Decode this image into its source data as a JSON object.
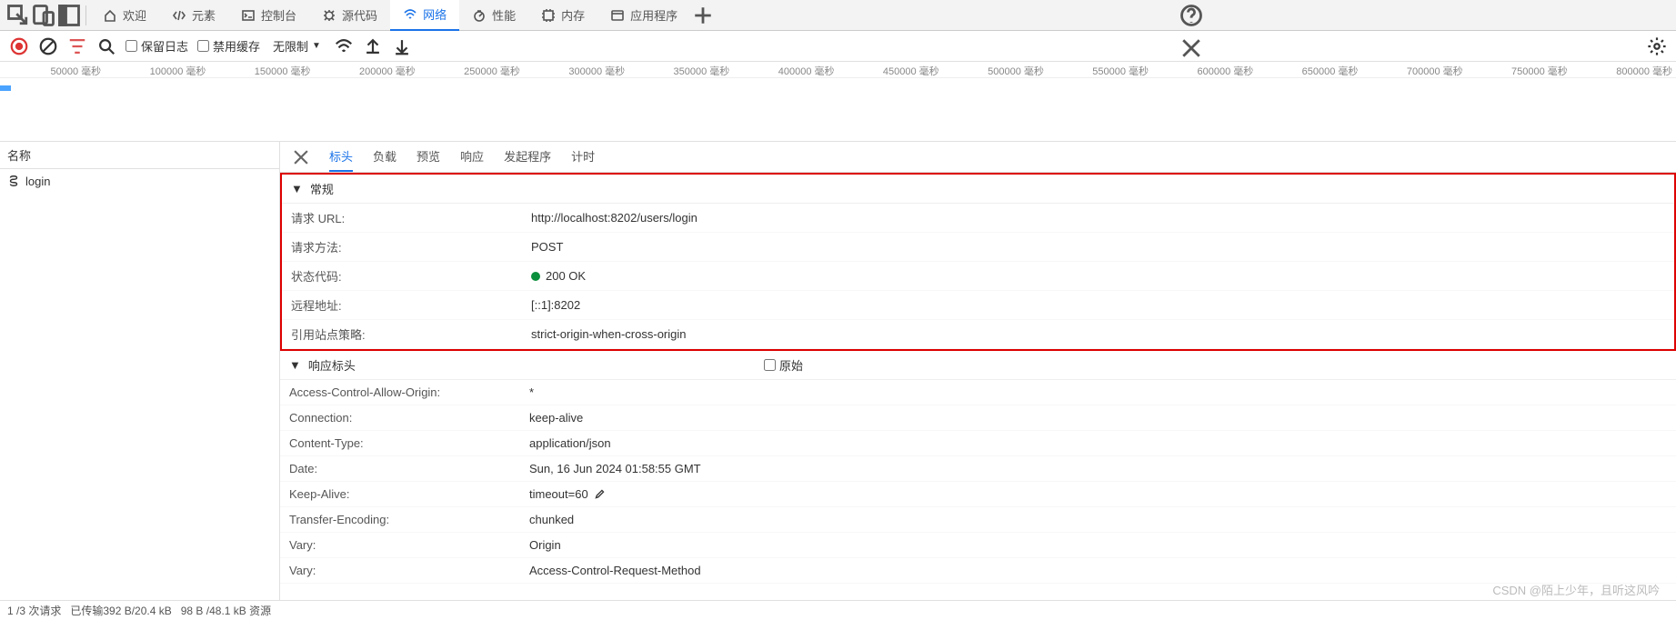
{
  "topbar": {
    "tabs": [
      {
        "icon": "home",
        "label": "欢迎"
      },
      {
        "icon": "code",
        "label": "元素"
      },
      {
        "icon": "console",
        "label": "控制台"
      },
      {
        "icon": "bug",
        "label": "源代码"
      },
      {
        "icon": "wifi",
        "label": "网络",
        "active": true
      },
      {
        "icon": "perf",
        "label": "性能"
      },
      {
        "icon": "mem",
        "label": "内存"
      },
      {
        "icon": "app",
        "label": "应用程序"
      }
    ]
  },
  "toolbar": {
    "preserve_log": "保留日志",
    "disable_cache": "禁用缓存",
    "throttle": "无限制"
  },
  "timeline": {
    "ticks": [
      "50000 毫秒",
      "100000 毫秒",
      "150000 毫秒",
      "200000 毫秒",
      "250000 毫秒",
      "300000 毫秒",
      "350000 毫秒",
      "400000 毫秒",
      "450000 毫秒",
      "500000 毫秒",
      "550000 毫秒",
      "600000 毫秒",
      "650000 毫秒",
      "700000 毫秒",
      "750000 毫秒",
      "800000 毫秒"
    ]
  },
  "left": {
    "header": "名称",
    "rows": [
      {
        "name": "login"
      }
    ]
  },
  "detailTabs": [
    "标头",
    "负载",
    "预览",
    "响应",
    "发起程序",
    "计时"
  ],
  "general": {
    "title": "常规",
    "rows": [
      {
        "k": "请求 URL:",
        "v": "http://localhost:8202/users/login"
      },
      {
        "k": "请求方法:",
        "v": "POST"
      },
      {
        "k": "状态代码:",
        "v": "200 OK",
        "dot": true
      },
      {
        "k": "远程地址:",
        "v": "[::1]:8202"
      },
      {
        "k": "引用站点策略:",
        "v": "strict-origin-when-cross-origin"
      }
    ]
  },
  "respHead": {
    "title": "响应标头",
    "raw": "原始",
    "rows": [
      {
        "k": "Access-Control-Allow-Origin:",
        "v": "*"
      },
      {
        "k": "Connection:",
        "v": "keep-alive"
      },
      {
        "k": "Content-Type:",
        "v": "application/json"
      },
      {
        "k": "Date:",
        "v": "Sun, 16 Jun 2024 01:58:55 GMT"
      },
      {
        "k": "Keep-Alive:",
        "v": "timeout=60",
        "edit": true
      },
      {
        "k": "Transfer-Encoding:",
        "v": "chunked"
      },
      {
        "k": "Vary:",
        "v": "Origin"
      },
      {
        "k": "Vary:",
        "v": "Access-Control-Request-Method"
      }
    ]
  },
  "status": {
    "req": "1 /3 次请求",
    "xfer": "已传输392 B/20.4 kB",
    "res": "98 B /48.1 kB 资源"
  },
  "watermark": "CSDN @陌上少年，且听这风吟"
}
